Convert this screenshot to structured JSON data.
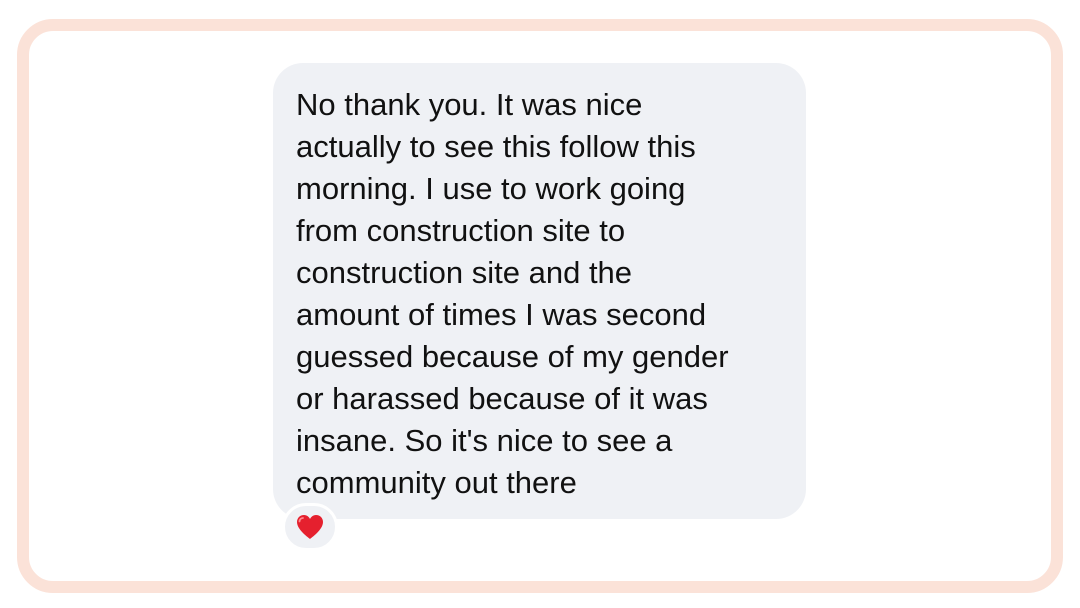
{
  "message": {
    "text": "No thank you. It was nice\nactually to see this follow this\nmorning. I use to work going\nfrom construction site to\nconstruction site and the\namount of times I was second\nguessed because of my gender\nor harassed because of it was\ninsane. So it's nice to see a\ncommunity out there",
    "reaction": "heart-icon",
    "reaction_color": "#e5202e"
  },
  "colors": {
    "frame_border": "#fbe2d8",
    "bubble_background": "#eff1f5",
    "text": "#111111"
  }
}
